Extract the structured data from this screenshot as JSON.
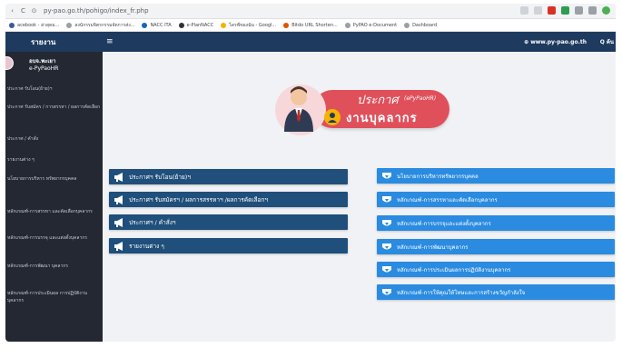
{
  "browser": {
    "url": "py-pao.go.th/pohigo/index_fr.php",
    "bookmarks": [
      {
        "label": "acebook - ล่าสุดม...",
        "color": "#3b5998"
      },
      {
        "label": "ลงนักรรมจิตรกรรมจัดการส่ง...",
        "color": "#9aa0a6"
      },
      {
        "label": "NACC ITA",
        "color": "#1565c0"
      },
      {
        "label": "e-PlanNACC",
        "color": "#333333"
      },
      {
        "label": "ไดรฟ์ของฉัน - Googl...",
        "color": "#f4b400"
      },
      {
        "label": "Bitdo URL Shorten...",
        "color": "#e65100"
      },
      {
        "label": "PyPAO e-Document",
        "color": "#9aa0a6"
      },
      {
        "label": "Dashboard",
        "color": "#9aa0a6"
      }
    ]
  },
  "topnav": {
    "title": "รายงาน",
    "hamburger": "≡",
    "site": "⊕ www.py-pao.go.th",
    "search": "Q ค้น"
  },
  "sidebar": {
    "user_name": "อบจ.พะเยา",
    "user_sub": "e-PyPaoHR",
    "items": [
      "ประกาศ รับโอน(ย้าย)ฯ",
      "ประกาศ รับสมัคร / การสรรหา / ผลการคัดเลือก",
      "ประกาศ / คำสั่ง",
      "รายงานต่าง ๆ",
      "นโยบายการบริหาร ทรัพยากรบุคคล",
      "หลักเกณฑ์-การสรรหา และคัดเลือกบุคลากร",
      "หลักเกณฑ์-การบรรจุ และแต่งตั้งบุคลากร",
      "หลักเกณฑ์-การพัฒนา บุคลากร",
      "หลักเกณฑ์-การประเมินผล การปฏิบัติงานบุคลากร"
    ]
  },
  "banner": {
    "line1": "ประกาศ",
    "line1_sub": "(ePyPaoHR)",
    "line2": "งานบุคลากร"
  },
  "left_buttons": [
    "ประกาศฯ รับโอน(ย้าย)ฯ",
    "ประกาศฯ รับสมัครฯ / ผลการสรรหาฯ /ผลการคัดเลือกฯ",
    "ประกาศฯ / คำสั่งฯ",
    "รายงานต่าง ๆ"
  ],
  "right_buttons": [
    "นโยบายการบริหารทรัพยากรบุคคล",
    "หลักเกณฑ์-การสรรหาและคัดเลือกบุคลากร",
    "หลักเกณฑ์-การบรรจุและแต่งตั้งบุคลากร",
    "หลักเกณฑ์-การพัฒนาบุคลากร",
    "หลักเกณฑ์-การประเมินผลการปฏิบัติงานบุคลากร",
    "หลักเกณฑ์-การให้คุณให้โทษและการสร้างขวัญกำลังใจ"
  ],
  "colors": {
    "topnav": "#1e3a5f",
    "sidebar": "#232833",
    "left_button": "#1f4f7a",
    "right_button": "#2a8be0",
    "banner": "#e0505b"
  }
}
